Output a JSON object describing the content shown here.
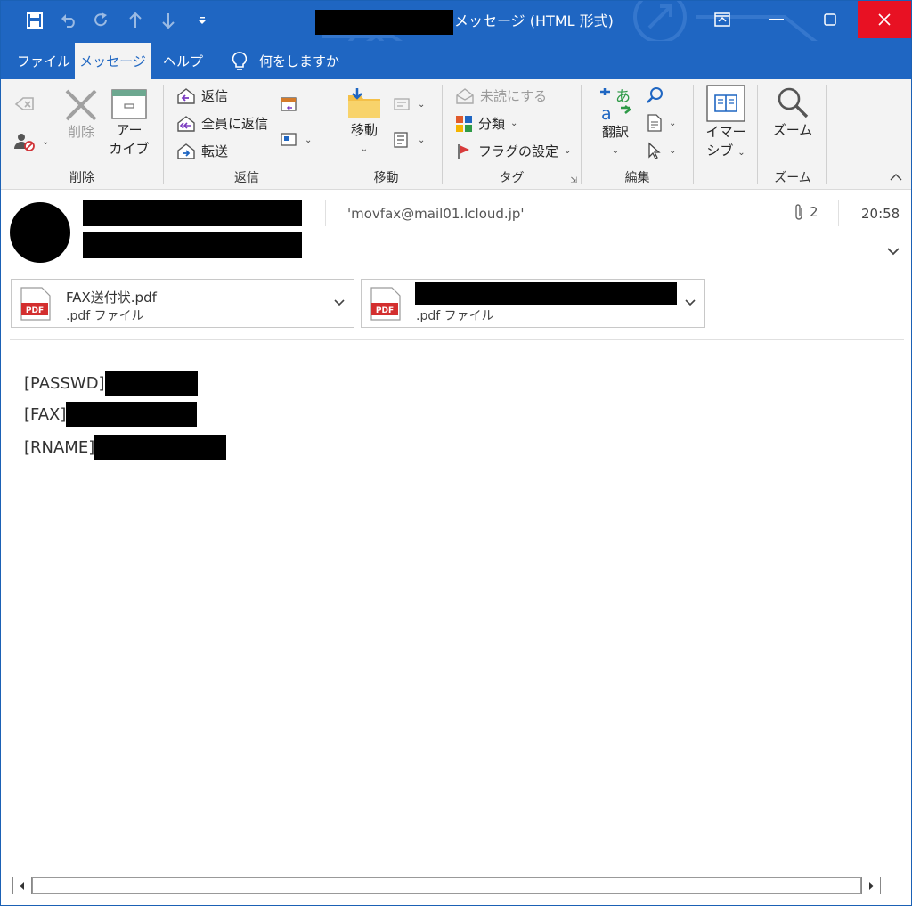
{
  "titlebar": {
    "title_suffix": "メッセージ (HTML 形式)",
    "brand_color": "#1f66c2",
    "close_color": "#e81123"
  },
  "menu": {
    "tabs": [
      {
        "label": "ファイル"
      },
      {
        "label": "メッセージ"
      },
      {
        "label": "ヘルプ"
      }
    ],
    "tell_me": "何をしますか"
  },
  "ribbon": {
    "groups": {
      "delete": {
        "label": "削除",
        "delete_btn": "削除",
        "archive_line1": "アー",
        "archive_line2": "カイブ"
      },
      "respond": {
        "label": "返信",
        "reply": "返信",
        "reply_all": "全員に返信",
        "forward": "転送"
      },
      "move": {
        "label": "移動",
        "move_btn": "移動"
      },
      "tags": {
        "label": "タグ",
        "unread": "未読にする",
        "categorize": "分類",
        "flag": "フラグの設定"
      },
      "editing": {
        "label": "編集",
        "translate": "翻訳",
        "translate_glyph_top": "あ",
        "translate_glyph_bottom": "a"
      },
      "immersive": {
        "label_line1": "イマー",
        "label_line2": "シブ"
      },
      "zoom": {
        "label": "ズーム",
        "zoom_btn": "ズーム"
      }
    }
  },
  "header": {
    "to": "'movfax@mail01.lcloud.jp'",
    "attachment_count": "2",
    "time": "20:58"
  },
  "attachments": [
    {
      "name": "FAX送付状.pdf",
      "type": ".pdf ファイル",
      "icon_label": "PDF"
    },
    {
      "name": "",
      "type": ".pdf ファイル",
      "icon_label": "PDF"
    }
  ],
  "body": {
    "passwd_label": "[PASSWD]",
    "fax_label": "[FAX]",
    "rname_label": "[RNAME]"
  },
  "icons": [
    "save-icon",
    "undo-icon",
    "redo-icon",
    "up-icon",
    "down-icon",
    "customize-icon",
    "lightbulb-icon",
    "paperclip-icon",
    "chevron-down-icon",
    "pdf-icon",
    "search-icon"
  ]
}
